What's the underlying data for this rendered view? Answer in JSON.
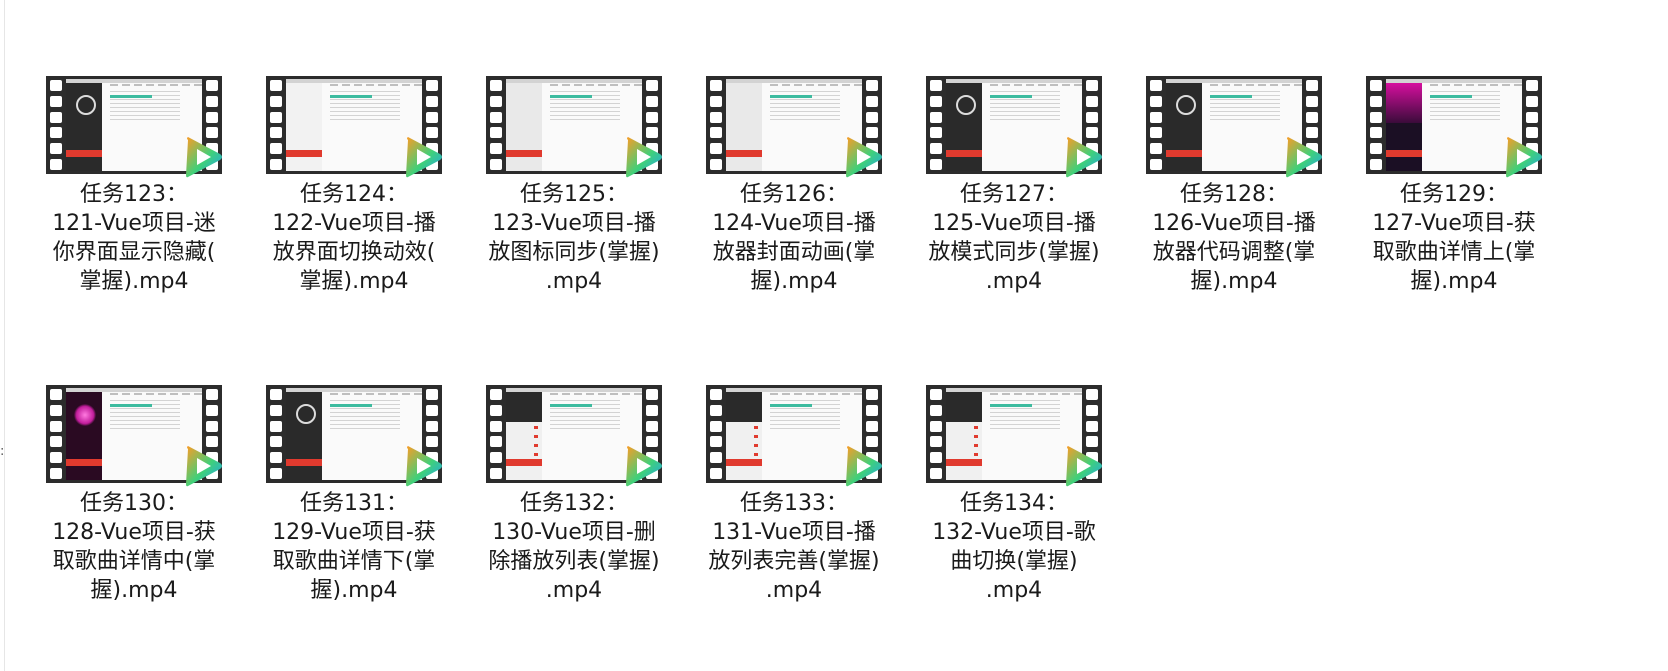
{
  "edge_glyph": ":",
  "files": [
    {
      "name": "任务123：121-Vue项目-迷你界面显示隐藏(掌握).mp4",
      "lines": [
        "任务123：",
        "121-Vue项目-迷",
        "你界面显示隐藏(",
        "掌握).mp4"
      ],
      "thumb": "dark"
    },
    {
      "name": "任务124：122-Vue项目-播放界面切换动效(掌握).mp4",
      "lines": [
        "任务124：",
        "122-Vue项目-播",
        "放界面切换动效(",
        "掌握).mp4"
      ],
      "thumb": "white"
    },
    {
      "name": "任务125：123-Vue项目-播放图标同步(掌握).mp4",
      "lines": [
        "任务125：",
        "123-Vue项目-播",
        "放图标同步(掌握)",
        ".mp4"
      ],
      "thumb": "light"
    },
    {
      "name": "任务126：124-Vue项目-播放器封面动画(掌握).mp4",
      "lines": [
        "任务126：",
        "124-Vue项目-播",
        "放器封面动画(掌",
        "握).mp4"
      ],
      "thumb": "light"
    },
    {
      "name": "任务127：125-Vue项目-播放模式同步(掌握).mp4",
      "lines": [
        "任务127：",
        "125-Vue项目-播",
        "放模式同步(掌握)",
        ".mp4"
      ],
      "thumb": "dark"
    },
    {
      "name": "任务128：126-Vue项目-播放器代码调整(掌握).mp4",
      "lines": [
        "任务128：",
        "126-Vue项目-播",
        "放器代码调整(掌",
        "握).mp4"
      ],
      "thumb": "dark"
    },
    {
      "name": "任务129：127-Vue项目-获取歌曲详情上(掌握).mp4",
      "lines": [
        "任务129：",
        "127-Vue项目-获",
        "取歌曲详情上(掌",
        "握).mp4"
      ],
      "thumb": "purple"
    },
    {
      "name": "任务130：128-Vue项目-获取歌曲详情中(掌握).mp4",
      "lines": [
        "任务130：",
        "128-Vue项目-获",
        "取歌曲详情中(掌",
        "握).mp4"
      ],
      "thumb": "pink"
    },
    {
      "name": "任务131：129-Vue项目-获取歌曲详情下(掌握).mp4",
      "lines": [
        "任务131：",
        "129-Vue项目-获",
        "取歌曲详情下(掌",
        "握).mp4"
      ],
      "thumb": "dark"
    },
    {
      "name": "任务132：130-Vue项目-删除播放列表(掌握).mp4",
      "lines": [
        "任务132：",
        "130-Vue项目-删",
        "除播放列表(掌握)",
        ".mp4"
      ],
      "thumb": "list"
    },
    {
      "name": "任务133：131-Vue项目-播放列表完善(掌握).mp4",
      "lines": [
        "任务133：",
        "131-Vue项目-播",
        "放列表完善(掌握)",
        ".mp4"
      ],
      "thumb": "list"
    },
    {
      "name": "任务134：132-Vue项目-歌曲切换(掌握).mp4",
      "lines": [
        "任务134：",
        "132-Vue项目-歌",
        "曲切换(掌握)",
        ".mp4"
      ],
      "thumb": "list"
    }
  ],
  "colors": {
    "film": "#2c2c2c",
    "play_orange": "#ff9b24",
    "play_blue": "#1e9ff5",
    "play_green": "#3fd07a"
  },
  "icons": {
    "video_file": "film-strip-icon",
    "player_badge": "tencent-video-play-icon"
  }
}
